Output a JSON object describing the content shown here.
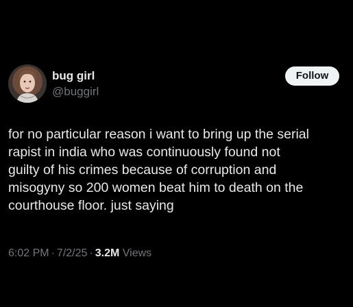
{
  "tweet": {
    "author": {
      "display_name": "bug girl",
      "handle": "@buggirl",
      "avatar": "profile-photo"
    },
    "follow_label": "Follow",
    "text_lines": [
      "for no particular reason i want to bring up the serial",
      "rapist in india who was continuously found not",
      "guilty of his crimes because of corruption and",
      "misogyny so 200 women beat him to death on the",
      "courthouse floor. just saying"
    ],
    "time": "6:02 PM",
    "date": "7/2/25",
    "separator": "·",
    "views_count": "3.2M",
    "views_label": "Views"
  },
  "colors": {
    "background": "#000000",
    "primary_text": "#e7e9ea",
    "secondary_text": "#71767b",
    "follow_button_bg": "#eff3f4",
    "follow_button_text": "#0f1419"
  }
}
